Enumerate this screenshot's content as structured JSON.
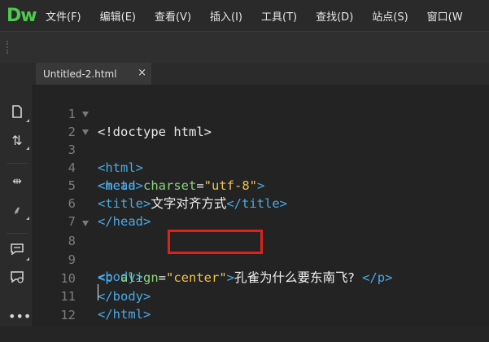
{
  "app": {
    "logo": "Dw"
  },
  "menu": [
    "文件(F)",
    "编辑(E)",
    "查看(V)",
    "插入(I)",
    "工具(T)",
    "查找(D)",
    "站点(S)",
    "窗口(W"
  ],
  "tab": {
    "title": "Untitled-2.html",
    "close": "×"
  },
  "sidebar_icons": [
    "file-icon",
    "sync-arrows-icon",
    "expand-icon",
    "wand-icon",
    "comment-icon",
    "comment-delete-icon",
    "more-icon"
  ],
  "code_lines": [
    {
      "num": "1",
      "fold": false
    },
    {
      "num": "2",
      "fold": true
    },
    {
      "num": "3",
      "fold": true
    },
    {
      "num": "4",
      "fold": false
    },
    {
      "num": "5",
      "fold": false
    },
    {
      "num": "6",
      "fold": false
    },
    {
      "num": "7",
      "fold": false
    },
    {
      "num": "8",
      "fold": true
    },
    {
      "num": "9",
      "fold": false
    },
    {
      "num": "10",
      "fold": false
    },
    {
      "num": "11",
      "fold": false
    },
    {
      "num": "12",
      "fold": false
    }
  ],
  "code": {
    "l1": "<!doctype html>",
    "l2": "<html>",
    "l3": "<head>",
    "l4_tag": "<meta ",
    "l4_attr": "charset",
    "l4_eq": "=",
    "l4_val": "\"utf-8\"",
    "l4_close": ">",
    "l5_open": "<title>",
    "l5_text": "文字对齐方式",
    "l5_close": "</title>",
    "l6": "</head>",
    "l8": "<body>",
    "l9_tag": "<p ",
    "l9_attr": "align",
    "l9_eq": "=",
    "l9_val": "\"center\"",
    "l9_gt": ">",
    "l9_text": "孔雀为什么要东南飞?",
    "l9_close": " </p>",
    "l10": "</body>",
    "l11": "</html>"
  }
}
